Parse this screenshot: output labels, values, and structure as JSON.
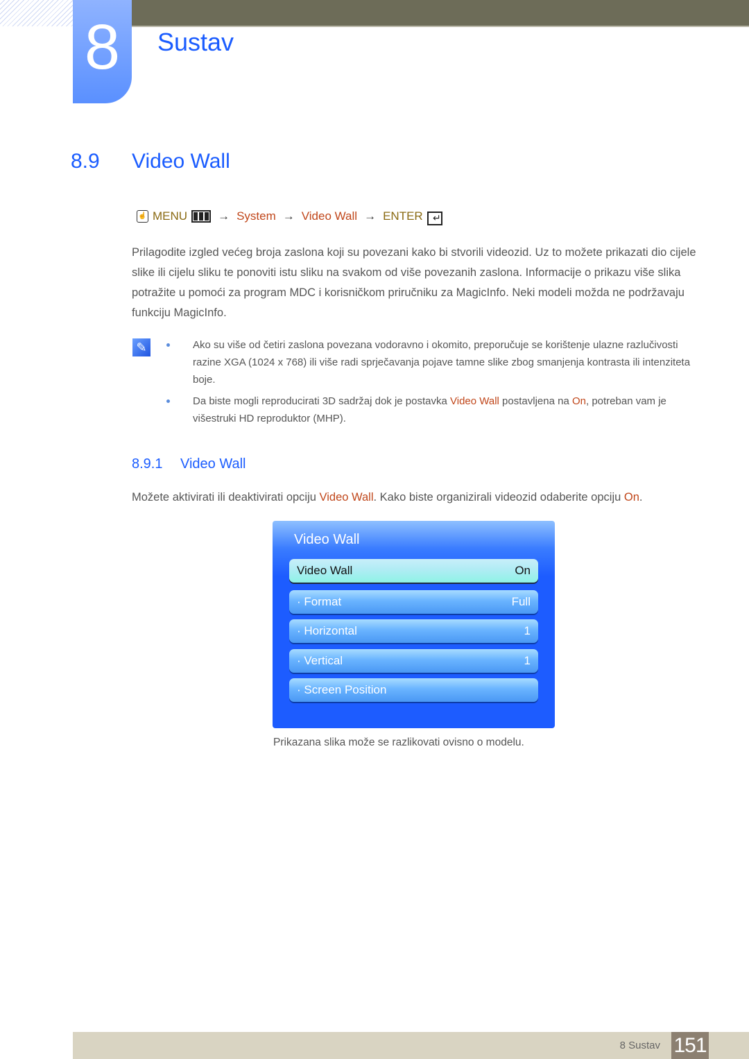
{
  "header": {
    "chapter_number": "8",
    "chapter_title": "Sustav"
  },
  "section": {
    "number": "8.9",
    "title": "Video Wall"
  },
  "menu_path": {
    "menu": "MENU",
    "arrow": "→",
    "system": "System",
    "video_wall": "Video Wall",
    "enter": "ENTER",
    "icons": [
      "hand-remote-icon",
      "menu-grid-icon",
      "enter-icon"
    ]
  },
  "intro_paragraph": "Prilagodite izgled većeg broja zaslona koji su povezani kako bi stvorili videozid. Uz to možete prikazati dio cijele slike ili cijelu sliku te ponoviti istu sliku na svakom od više povezanih zaslona. Informacije o prikazu više slika potražite u pomoći za program MDC i korisničkom priručniku za MagicInfo. Neki modeli možda ne podržavaju funkciju MagicInfo.",
  "notes": {
    "icon": "note-pencil-icon",
    "items": [
      {
        "text": "Ako su više od četiri zaslona povezana vodoravno i okomito, preporučuje se korištenje ulazne razlučivosti razine XGA (1024 x 768) ili više radi sprječavanja pojave tamne slike zbog smanjenja kontrasta ili intenziteta boje."
      },
      {
        "pre": "Da biste mogli reproducirati 3D sadržaj dok je postavka ",
        "hl1": "Video Wall",
        "mid": " postavljena na ",
        "hl2": "On",
        "post": ", potreban vam je višestruki HD reproduktor (MHP)."
      }
    ]
  },
  "subsection": {
    "number": "8.9.1",
    "title": "Video Wall",
    "pre": "Možete aktivirati ili deaktivirati opciju ",
    "hl1": "Video Wall",
    "mid": ". Kako biste organizirali videozid odaberite opciju ",
    "hl2": "On",
    "post": "."
  },
  "osd": {
    "title": "Video Wall",
    "rows": [
      {
        "label": "Video Wall",
        "value": "On",
        "selected": true
      },
      {
        "label": "· Format",
        "value": "Full"
      },
      {
        "label": "· Horizontal",
        "value": "1"
      },
      {
        "label": "· Vertical",
        "value": "1"
      },
      {
        "label": "· Screen Position",
        "value": ""
      }
    ]
  },
  "caption": "Prikazana slika može se razlikovati ovisno o modelu.",
  "footer": {
    "chapter": "8 Sustav",
    "page": "151"
  },
  "colors": {
    "heading_blue": "#1a5cff",
    "highlight_orange": "#c0461a",
    "menu_gold": "#8a6a12",
    "top_bar": "#6d6c58",
    "footer_bar": "#d9d4c2",
    "page_badge": "#8c8071"
  }
}
